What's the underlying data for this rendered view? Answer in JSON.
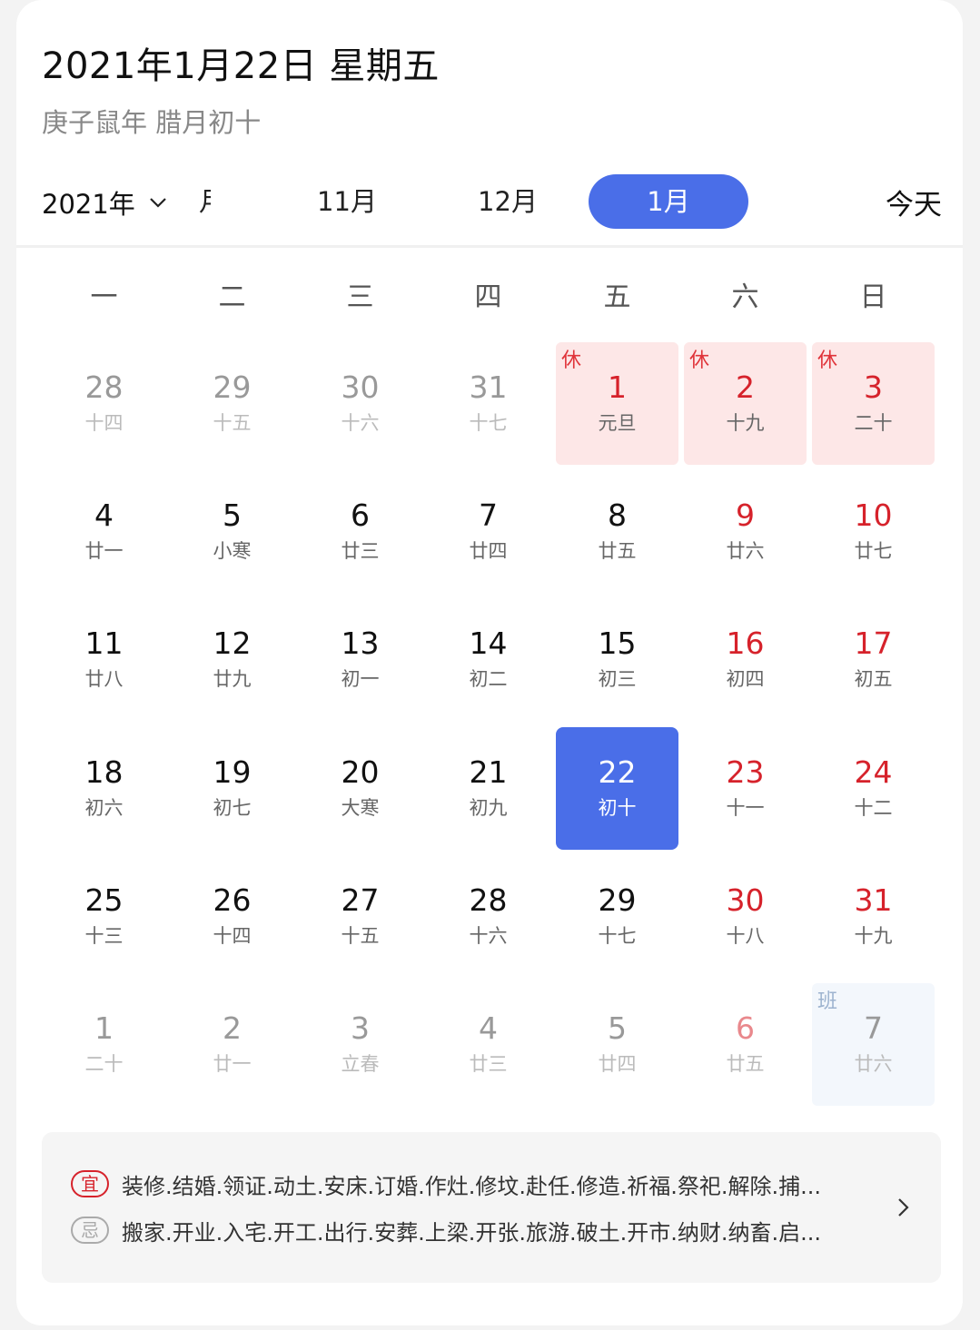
{
  "header": {
    "date_title": "2021年1月22日 星期五",
    "lunar_title": "庚子鼠年 腊月初十"
  },
  "month_bar": {
    "year_label": "2021年",
    "months": [
      {
        "label": "月",
        "state": "partial"
      },
      {
        "label": "11月",
        "state": "normal"
      },
      {
        "label": "12月",
        "state": "normal"
      },
      {
        "label": "1月",
        "state": "active"
      }
    ],
    "today_label": "今天"
  },
  "weekdays": [
    "一",
    "二",
    "三",
    "四",
    "五",
    "六",
    "日"
  ],
  "weeks": [
    [
      {
        "day": "28",
        "lunar": "十四",
        "kind": "other"
      },
      {
        "day": "29",
        "lunar": "十五",
        "kind": "other"
      },
      {
        "day": "30",
        "lunar": "十六",
        "kind": "other"
      },
      {
        "day": "31",
        "lunar": "十七",
        "kind": "other"
      },
      {
        "day": "1",
        "lunar": "元旦",
        "kind": "holiday",
        "tag": "休"
      },
      {
        "day": "2",
        "lunar": "十九",
        "kind": "holiday",
        "tag": "休"
      },
      {
        "day": "3",
        "lunar": "二十",
        "kind": "holiday",
        "tag": "休"
      }
    ],
    [
      {
        "day": "4",
        "lunar": "廿一",
        "kind": "normal"
      },
      {
        "day": "5",
        "lunar": "小寒",
        "kind": "normal"
      },
      {
        "day": "6",
        "lunar": "廿三",
        "kind": "normal"
      },
      {
        "day": "7",
        "lunar": "廿四",
        "kind": "normal"
      },
      {
        "day": "8",
        "lunar": "廿五",
        "kind": "normal"
      },
      {
        "day": "9",
        "lunar": "廿六",
        "kind": "weekend"
      },
      {
        "day": "10",
        "lunar": "廿七",
        "kind": "weekend"
      }
    ],
    [
      {
        "day": "11",
        "lunar": "廿八",
        "kind": "normal"
      },
      {
        "day": "12",
        "lunar": "廿九",
        "kind": "normal"
      },
      {
        "day": "13",
        "lunar": "初一",
        "kind": "normal"
      },
      {
        "day": "14",
        "lunar": "初二",
        "kind": "normal"
      },
      {
        "day": "15",
        "lunar": "初三",
        "kind": "normal"
      },
      {
        "day": "16",
        "lunar": "初四",
        "kind": "weekend"
      },
      {
        "day": "17",
        "lunar": "初五",
        "kind": "weekend"
      }
    ],
    [
      {
        "day": "18",
        "lunar": "初六",
        "kind": "normal"
      },
      {
        "day": "19",
        "lunar": "初七",
        "kind": "normal"
      },
      {
        "day": "20",
        "lunar": "大寒",
        "kind": "normal"
      },
      {
        "day": "21",
        "lunar": "初九",
        "kind": "normal"
      },
      {
        "day": "22",
        "lunar": "初十",
        "kind": "selected"
      },
      {
        "day": "23",
        "lunar": "十一",
        "kind": "weekend"
      },
      {
        "day": "24",
        "lunar": "十二",
        "kind": "weekend"
      }
    ],
    [
      {
        "day": "25",
        "lunar": "十三",
        "kind": "normal"
      },
      {
        "day": "26",
        "lunar": "十四",
        "kind": "normal"
      },
      {
        "day": "27",
        "lunar": "十五",
        "kind": "normal"
      },
      {
        "day": "28",
        "lunar": "十六",
        "kind": "normal"
      },
      {
        "day": "29",
        "lunar": "十七",
        "kind": "normal"
      },
      {
        "day": "30",
        "lunar": "十八",
        "kind": "weekend"
      },
      {
        "day": "31",
        "lunar": "十九",
        "kind": "weekend"
      }
    ],
    [
      {
        "day": "1",
        "lunar": "二十",
        "kind": "other"
      },
      {
        "day": "2",
        "lunar": "廿一",
        "kind": "other"
      },
      {
        "day": "3",
        "lunar": "立春",
        "kind": "other"
      },
      {
        "day": "4",
        "lunar": "廿三",
        "kind": "other"
      },
      {
        "day": "5",
        "lunar": "廿四",
        "kind": "other"
      },
      {
        "day": "6",
        "lunar": "廿五",
        "kind": "other-weekend"
      },
      {
        "day": "7",
        "lunar": "廿六",
        "kind": "workday",
        "tag": "班"
      }
    ]
  ],
  "almanac": {
    "good_label": "宜",
    "good_text": "装修.结婚.领证.动土.安床.订婚.作灶.修坟.赴任.修造.祈福.祭祀.解除.捕...",
    "bad_label": "忌",
    "bad_text": "搬家.开业.入宅.开工.出行.安葬.上梁.开张.旅游.破土.开市.纳财.纳畜.启..."
  },
  "colors": {
    "accent": "#4a6ee8",
    "holiday_bg": "#fde7e7",
    "holiday_red": "#d6222b"
  }
}
